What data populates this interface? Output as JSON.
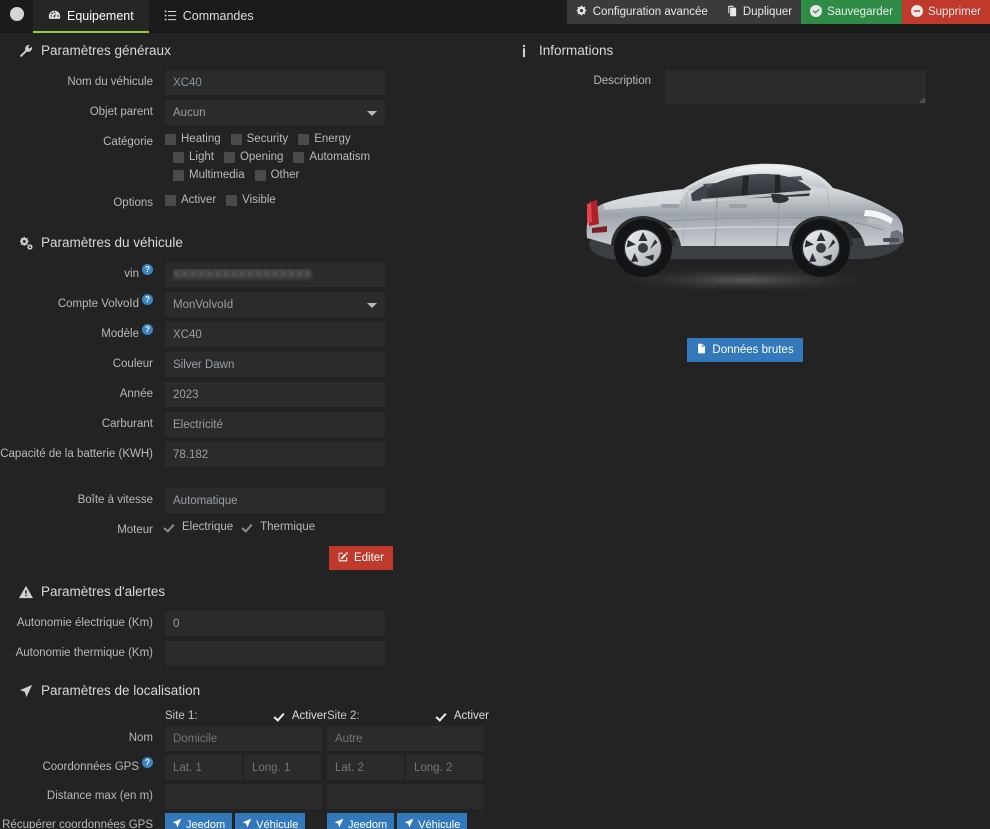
{
  "topbar": {
    "back_icon": "arrow-left-circle-icon",
    "tabs": [
      {
        "label": "Equipement",
        "icon": "tachometer-icon",
        "active": true
      },
      {
        "label": "Commandes",
        "icon": "list-icon",
        "active": false
      }
    ],
    "actions": [
      {
        "label": "Configuration avancée",
        "icon": "gears-icon",
        "style": "default"
      },
      {
        "label": "Dupliquer",
        "icon": "copy-icon",
        "style": "default"
      },
      {
        "label": "Sauvegarder",
        "icon": "check-circle-icon",
        "style": "save"
      },
      {
        "label": "Supprimer",
        "icon": "minus-circle-icon",
        "style": "delete"
      }
    ]
  },
  "general": {
    "title": "Paramètres généraux",
    "title_icon": "wrench-icon",
    "name_label": "Nom du véhicule",
    "name_value": "XC40",
    "parent_label": "Objet parent",
    "parent_value": "Aucun",
    "category_label": "Catégorie",
    "categories": [
      {
        "label": "Heating",
        "checked": false
      },
      {
        "label": "Security",
        "checked": false
      },
      {
        "label": "Energy",
        "checked": false
      },
      {
        "label": "Light",
        "checked": false
      },
      {
        "label": "Opening",
        "checked": false
      },
      {
        "label": "Automatism",
        "checked": false
      },
      {
        "label": "Multimedia",
        "checked": false
      },
      {
        "label": "Other",
        "checked": false
      }
    ],
    "options_label": "Options",
    "options": [
      {
        "label": "Activer",
        "checked": false
      },
      {
        "label": "Visible",
        "checked": false
      }
    ]
  },
  "vehicle": {
    "title": "Paramètres du véhicule",
    "title_icon": "cogs-icon",
    "vin_label": "vin",
    "vin_value": "XXXXXXXXXXXXXXXXX",
    "account_label": "Compte VolvoId",
    "account_value": "MonVolvoId",
    "model_label": "Modèle",
    "model_value": "XC40",
    "color_label": "Couleur",
    "color_value": "Silver Dawn",
    "year_label": "Année",
    "year_value": "2023",
    "fuel_label": "Carburant",
    "fuel_value": "Electricité",
    "battery_label": "Capacité de la batterie (KWH)",
    "battery_value": "78.182",
    "gearbox_label": "Boîte à vitesse",
    "gearbox_value": "Automatique",
    "engine_label": "Moteur",
    "engines": [
      {
        "label": "Electrique",
        "checked": true
      },
      {
        "label": "Thermique",
        "checked": true
      }
    ],
    "edit_label": "Editer",
    "edit_icon": "pencil-square-icon"
  },
  "alerts": {
    "title": "Paramètres d'alertes",
    "title_icon": "warning-triangle-icon",
    "electric_label": "Autonomie électrique (Km)",
    "electric_value": "0",
    "thermal_label": "Autonomie thermique (Km)",
    "thermal_value": ""
  },
  "localisation": {
    "title": "Paramètres de localisation",
    "title_icon": "location-arrow-icon",
    "site1_label": "Site 1:",
    "site2_label": "Site 2:",
    "enable_label": "Activer",
    "site1_enabled": true,
    "site2_enabled": true,
    "name_label": "Nom",
    "gps_label": "Coordonnées GPS",
    "distance_label": "Distance max (en m)",
    "retrieve_label": "Récupérer coordonnées GPS",
    "site1_name_placeholder": "Domicile",
    "site2_name_placeholder": "Autre",
    "lat1_placeholder": "Lat. 1",
    "long1_placeholder": "Long. 1",
    "lat2_placeholder": "Lat. 2",
    "long2_placeholder": "Long. 2",
    "site1_distance": "",
    "site2_distance": "",
    "jeedom_label": "Jeedom",
    "vehicle_label": "Véhicule",
    "button_icon": "location-arrow-icon"
  },
  "informations": {
    "title": "Informations",
    "title_icon": "info-icon",
    "description_label": "Description",
    "description_value": "",
    "vehicle_image": "volvo-xc40-side-silver",
    "raw_data_label": "Données brutes",
    "raw_data_icon": "file-icon"
  },
  "colors": {
    "background": "#232323",
    "topbar": "#1b1b1b",
    "tab_active_underline": "#9bcc28",
    "save_green": "#2f8c46",
    "delete_red": "#c0392b",
    "primary_blue": "#3278ba",
    "help_blue": "#3a84c9",
    "input_bg": "#2b2b2b"
  }
}
